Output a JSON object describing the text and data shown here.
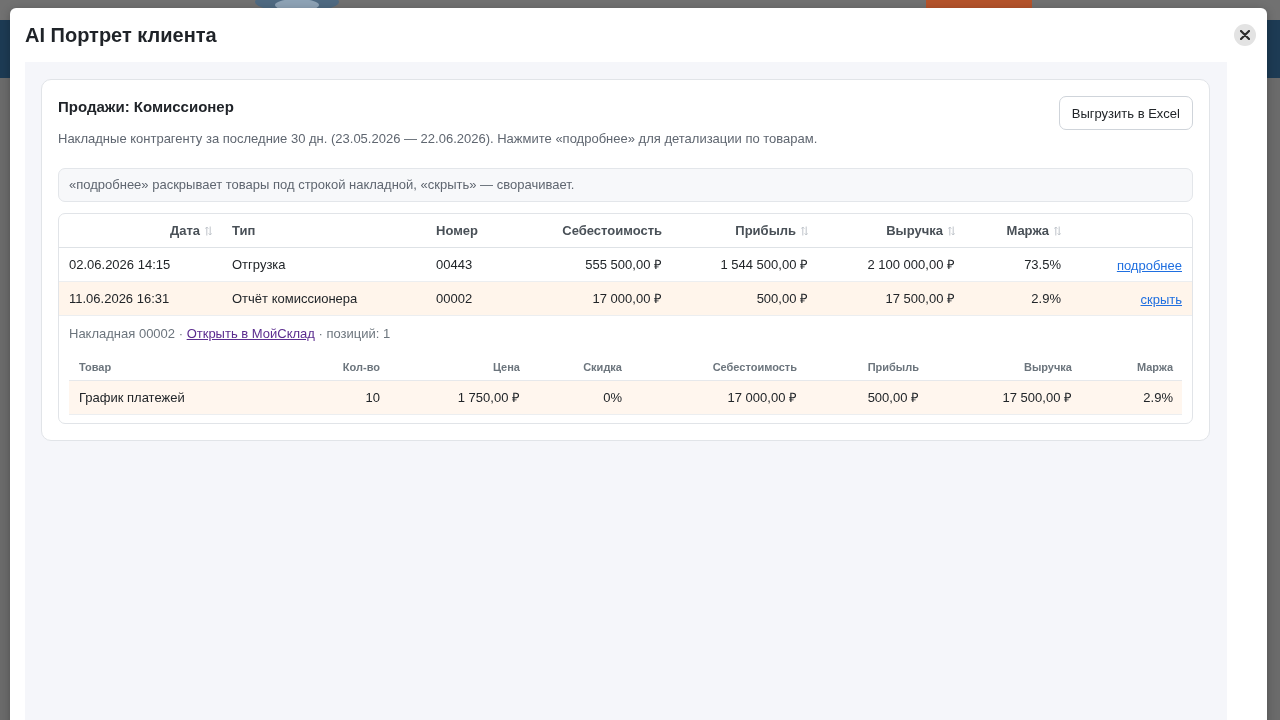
{
  "window": {
    "title": "AI Портрет клиента"
  },
  "report": {
    "title": "Продажи: Комиссионер",
    "subtitle": "Накладные контрагенту за последние 30 дн. (23.05.2026 — 22.06.2026). Нажмите «подробнее» для детализации по товарам.",
    "export_button": "Выгрузить в Excel",
    "hint": "«подробнее» раскрывает товары под строкой накладной, «скрыть» — сворачивает."
  },
  "table": {
    "columns": [
      {
        "label": "Дата",
        "kind": "date",
        "sortable": true
      },
      {
        "label": "Тип",
        "kind": "text",
        "sortable": false
      },
      {
        "label": "Номер",
        "kind": "code",
        "sortable": false
      },
      {
        "label": "Себестоимость",
        "kind": "money",
        "sortable": false
      },
      {
        "label": "Прибыль",
        "kind": "money",
        "sortable": true
      },
      {
        "label": "Выручка",
        "kind": "money",
        "sortable": true
      },
      {
        "label": "Маржа",
        "kind": "percent",
        "sortable": true
      }
    ],
    "rows": [
      {
        "cells": [
          "02.06.2026 14:15",
          "Отгрузка",
          "00443",
          "555 500,00 ₽",
          "1 544 500,00 ₽",
          "2 100 000,00 ₽",
          "73.5%"
        ],
        "action": "подробнее",
        "expanded": false
      },
      {
        "cells": [
          "11.06.2026 16:31",
          "Отчёт комиссионера",
          "00002",
          "17 000,00 ₽",
          "500,00 ₽",
          "17 500,00 ₽",
          "2.9%"
        ],
        "action": "скрыть",
        "expanded": true,
        "detail": {
          "summary_start": "Накладная 00002 ·",
          "link": {
            "label": "Открыть в МойСклад",
            "visited": true
          },
          "summary_end": "· позиций: 1",
          "columns": [
            {
              "label": "Товар",
              "kind": "text"
            },
            {
              "label": "Кол-во",
              "kind": "number"
            },
            {
              "label": "Цена",
              "kind": "money"
            },
            {
              "label": "Скидка",
              "kind": "percent"
            },
            {
              "label": "Себестоимость",
              "kind": "money"
            },
            {
              "label": "Прибыль",
              "kind": "money"
            },
            {
              "label": "Выручка",
              "kind": "money"
            },
            {
              "label": "Маржа",
              "kind": "percent"
            }
          ],
          "rows": [
            {
              "cells": [
                "График платежей",
                "10",
                "1 750,00 ₽",
                "0%",
                "17 000,00 ₽",
                "500,00 ₽",
                "17 500,00 ₽",
                "2.9%"
              ]
            }
          ]
        }
      }
    ]
  }
}
